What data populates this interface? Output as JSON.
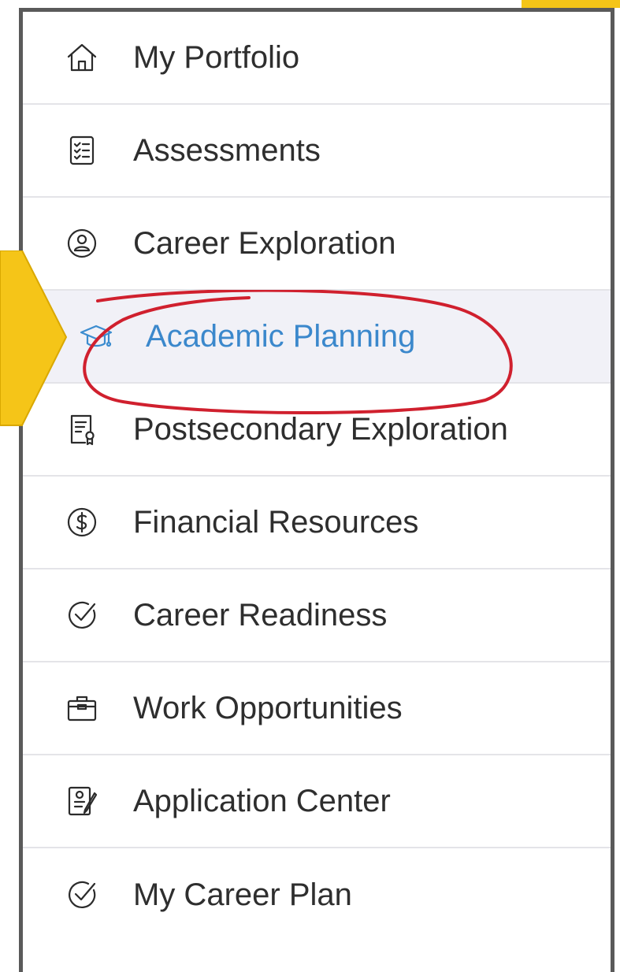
{
  "menu": {
    "items": [
      {
        "label": "My Portfolio",
        "icon": "home-icon",
        "active": false
      },
      {
        "label": "Assessments",
        "icon": "checklist-icon",
        "active": false
      },
      {
        "label": "Career Exploration",
        "icon": "person-badge-icon",
        "active": false
      },
      {
        "label": "Academic Planning",
        "icon": "graduation-cap-icon",
        "active": true
      },
      {
        "label": "Postsecondary Exploration",
        "icon": "certificate-icon",
        "active": false
      },
      {
        "label": "Financial Resources",
        "icon": "dollar-circle-icon",
        "active": false
      },
      {
        "label": "Career Readiness",
        "icon": "check-circle-icon",
        "active": false
      },
      {
        "label": "Work Opportunities",
        "icon": "briefcase-icon",
        "active": false
      },
      {
        "label": "Application Center",
        "icon": "application-form-icon",
        "active": false
      },
      {
        "label": "My Career Plan",
        "icon": "check-circle-icon",
        "active": false
      }
    ]
  },
  "colors": {
    "active_text": "#3b88cc",
    "active_background": "#f1f1f7",
    "annotation_arrow": "#f5c518",
    "annotation_circle": "#d0202e",
    "frame_border": "#5a5a5a"
  }
}
